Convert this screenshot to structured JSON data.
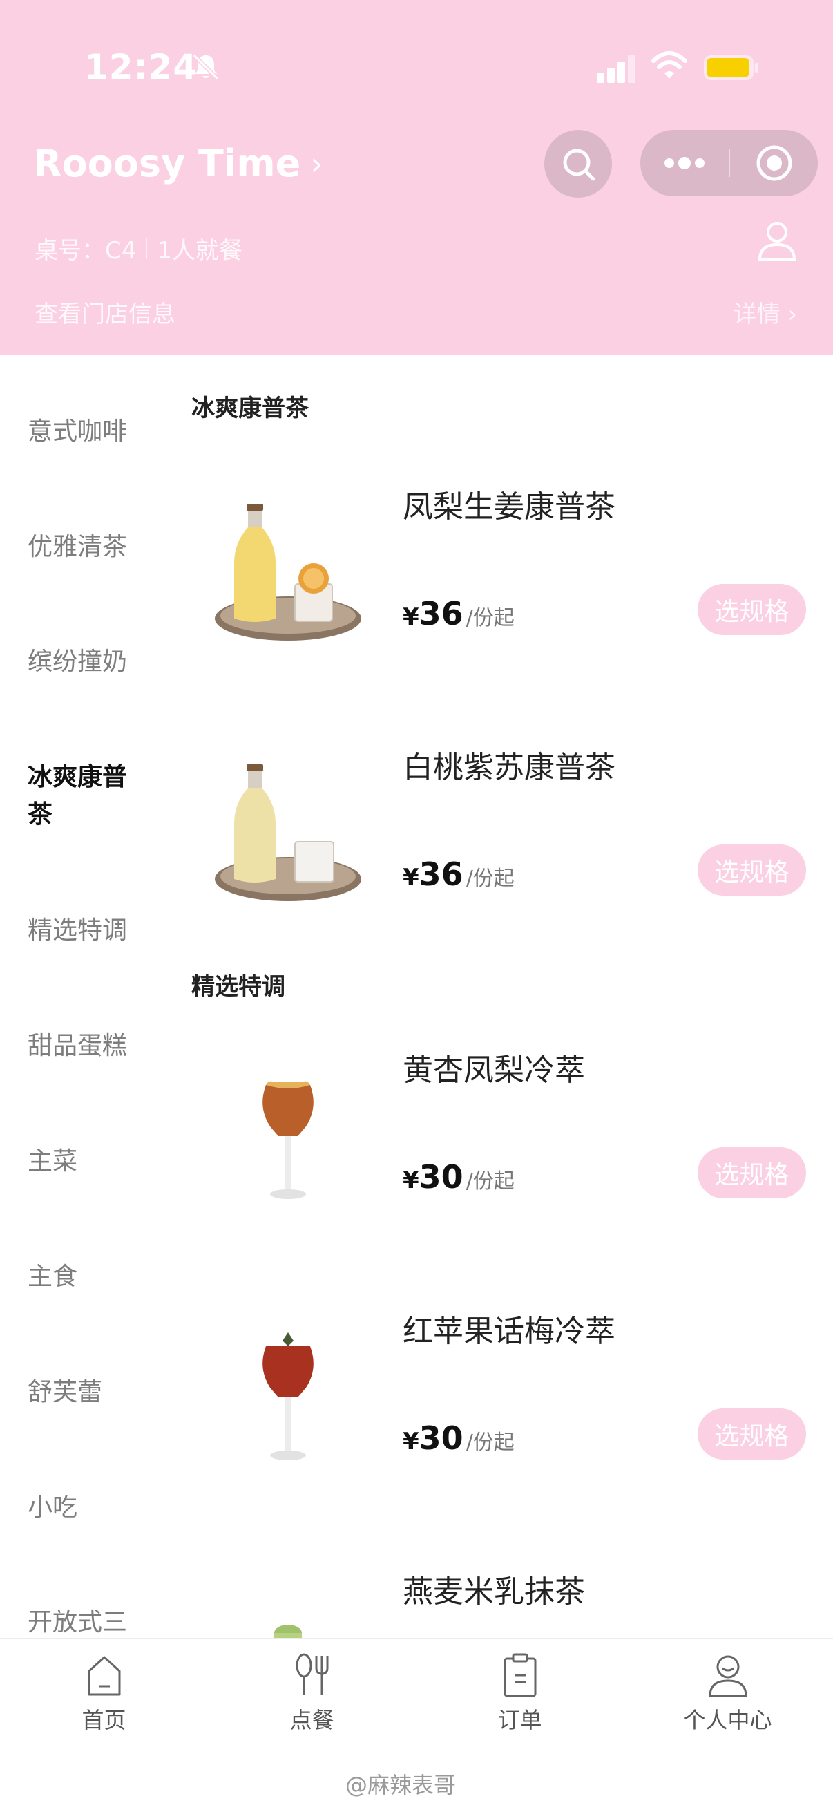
{
  "status_bar": {
    "time": "12:24"
  },
  "header": {
    "store_name": "Rooosy Time",
    "store_chevron": "›",
    "table_label": "桌号：C4",
    "diners": "1人就餐",
    "store_info": "查看门店信息",
    "details": "详情 ›",
    "icons": [
      "bell-off-icon",
      "signal-icon",
      "wifi-icon",
      "battery-icon",
      "search-icon",
      "more-dots-icon",
      "target-icon",
      "user-icon"
    ],
    "colors": {
      "header_bg": "#fbd0e2",
      "button_bg": "#fbd0e2"
    }
  },
  "sidebar": {
    "categories": [
      {
        "label": "意式咖啡",
        "active": false
      },
      {
        "label": "优雅清茶",
        "active": false
      },
      {
        "label": "缤纷撞奶",
        "active": false
      },
      {
        "label": "冰爽康普茶",
        "active": true
      },
      {
        "label": "精选特调",
        "active": false
      },
      {
        "label": "甜品蛋糕",
        "active": false
      },
      {
        "label": "主菜",
        "active": false
      },
      {
        "label": "主食",
        "active": false
      },
      {
        "label": "舒芙蕾",
        "active": false
      },
      {
        "label": "小吃",
        "active": false
      },
      {
        "label": "开放式三",
        "active": false
      }
    ]
  },
  "sections": [
    {
      "title": "冰爽康普茶",
      "products": [
        {
          "name": "凤梨生姜康普茶",
          "currency": "¥",
          "price": "36",
          "unit": "/份起",
          "button": "选规格"
        },
        {
          "name": "白桃紫苏康普茶",
          "currency": "¥",
          "price": "36",
          "unit": "/份起",
          "button": "选规格"
        }
      ]
    },
    {
      "title": "精选特调",
      "products": [
        {
          "name": "黄杏凤梨冷萃",
          "currency": "¥",
          "price": "30",
          "unit": "/份起",
          "button": "选规格"
        },
        {
          "name": "红苹果话梅冷萃",
          "currency": "¥",
          "price": "30",
          "unit": "/份起",
          "button": "选规格"
        },
        {
          "name": "燕麦米乳抹茶",
          "currency": "¥",
          "price": "",
          "unit": "",
          "button": ""
        }
      ]
    }
  ],
  "tabbar": {
    "tabs": [
      {
        "label": "首页",
        "icon": "home-icon"
      },
      {
        "label": "点餐",
        "icon": "utensils-icon"
      },
      {
        "label": "订单",
        "icon": "clipboard-icon"
      },
      {
        "label": "个人中心",
        "icon": "profile-icon"
      }
    ]
  },
  "watermark": "@麻辣表哥"
}
